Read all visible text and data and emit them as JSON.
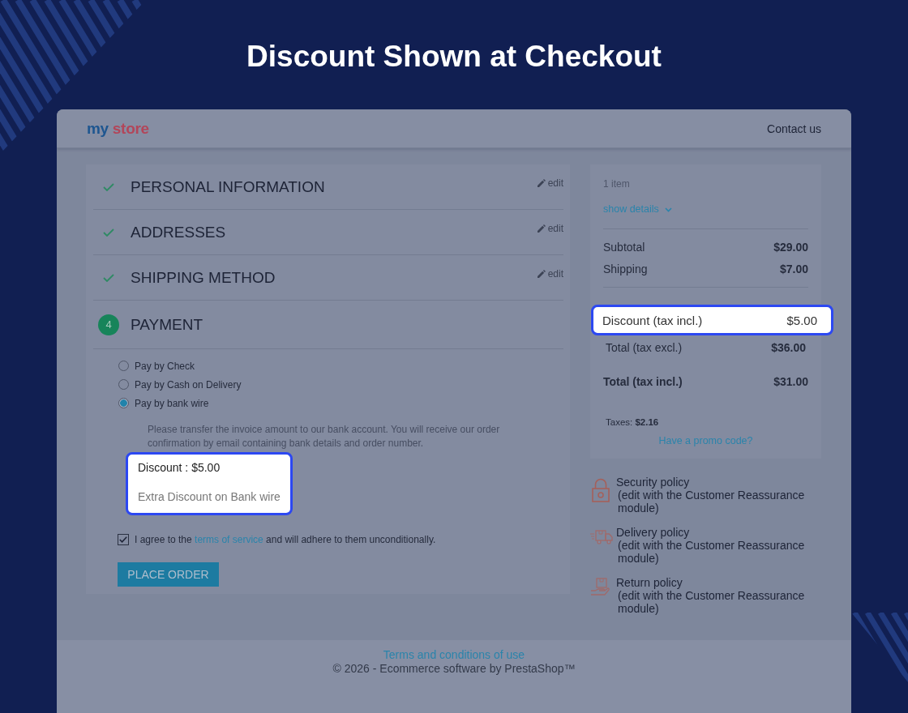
{
  "banner": {
    "title": "Discount Shown at Checkout"
  },
  "header": {
    "logo": "my store",
    "contact_link": "Contact us"
  },
  "checkout_steps": [
    {
      "title": "PERSONAL INFORMATION",
      "complete": true,
      "edit": "edit"
    },
    {
      "title": "ADDRESSES",
      "complete": true,
      "edit": "edit"
    },
    {
      "title": "SHIPPING METHOD",
      "complete": true,
      "edit": "edit"
    },
    {
      "title": "PAYMENT",
      "complete": false,
      "number": "4"
    }
  ],
  "payment": {
    "options": [
      {
        "label": "Pay by Check",
        "selected": false
      },
      {
        "label": "Pay by Cash on Delivery",
        "selected": false
      },
      {
        "label": "Pay by bank wire",
        "selected": true
      }
    ],
    "instructions": "Please transfer the invoice amount to our bank account. You will receive our order confirmation by email containing bank details and order number.",
    "discount": {
      "amount": "Discount : $5.00",
      "description": "Extra Discount on Bank wire"
    },
    "terms": {
      "checked": true,
      "text_before": "I agree to the ",
      "link": "terms of service",
      "text_after": " and will adhere to them unconditionally."
    },
    "button": "PLACE ORDER"
  },
  "cart_summary": {
    "item_count": "1 item",
    "details_link": "show details",
    "lines": [
      {
        "label": "Subtotal",
        "value": "$29.00"
      },
      {
        "label": "Shipping",
        "value": "$7.00"
      }
    ],
    "discount": {
      "label": "Discount (tax incl.)",
      "value": "$5.00"
    },
    "totals": [
      {
        "kind": "excl",
        "label": "Total (tax excl.)",
        "value": "$36.00"
      },
      {
        "kind": "incl",
        "label": "Total (tax incl.)",
        "value": "$31.00"
      }
    ],
    "taxes": "Taxes: **$2.16**",
    "promo_link": "Have a promo code?"
  },
  "reassurance": [
    {
      "kind": "lock",
      "title": "Security policy",
      "note": "(edit with the Customer Reassurance module)"
    },
    {
      "kind": "truck",
      "title": "Delivery policy",
      "note": "(edit with the Customer Reassurance module)"
    },
    {
      "kind": "return",
      "title": "Return policy",
      "note": "(edit with the Customer Reassurance module)"
    }
  ],
  "footer": {
    "link": "Terms and conditions of use",
    "copyright": "© 2026 - Ecommerce software by PrestaShop™"
  }
}
